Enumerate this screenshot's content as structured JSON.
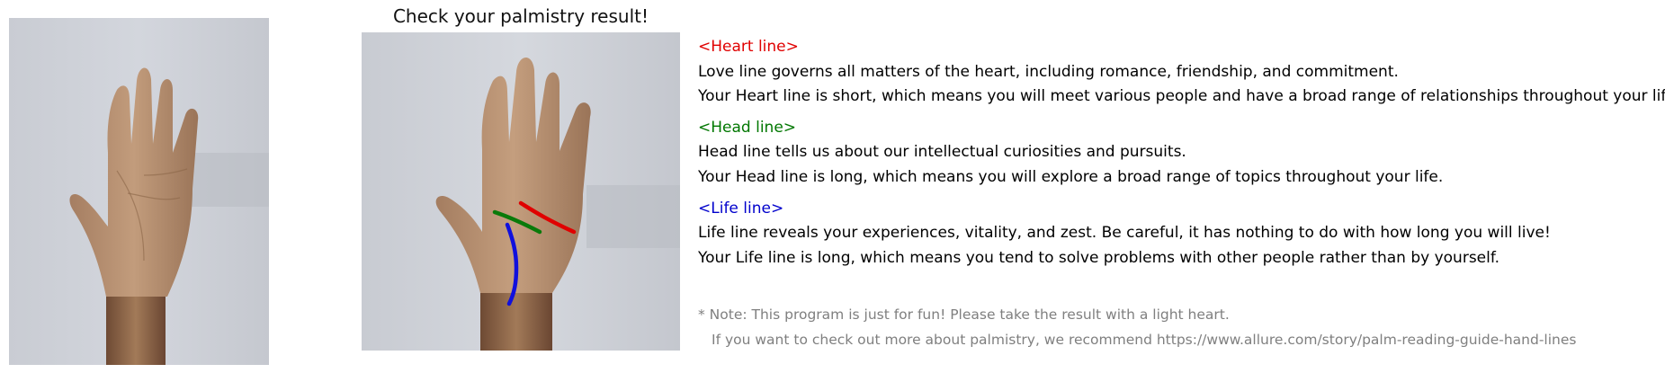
{
  "title": "Check your palmistry result!",
  "sections": [
    {
      "header": "<Heart line>",
      "color": "#e00000",
      "lines": [
        "Love line governs all matters of the heart, including romance, friendship, and commitment.",
        "Your Heart line is short, which means you will meet various people and have a broad range of relationships throughout your life."
      ]
    },
    {
      "header": "<Head line>",
      "color": "#007700",
      "lines": [
        "Head line tells us about our intellectual curiosities and pursuits.",
        "Your Head line is long, which means you will explore a broad range of topics throughout your life."
      ]
    },
    {
      "header": "<Life line>",
      "color": "#0000cc",
      "lines": [
        "Life line reveals your experiences, vitality, and zest. Be careful, it has nothing to do with how long you will live!",
        "Your Life line is long, which means you tend to solve problems with other people rather than by yourself."
      ]
    }
  ],
  "note": {
    "line1": "* Note: This program is just for fun! Please take the result with a light heart.",
    "line2": "If you want to check out more about palmistry, we recommend https://www.allure.com/story/palm-reading-guide-hand-lines"
  },
  "colors": {
    "heart_line": "#e00000",
    "head_line": "#0a7a0a",
    "life_line": "#1010dd",
    "note_text": "#7f7f7f"
  }
}
